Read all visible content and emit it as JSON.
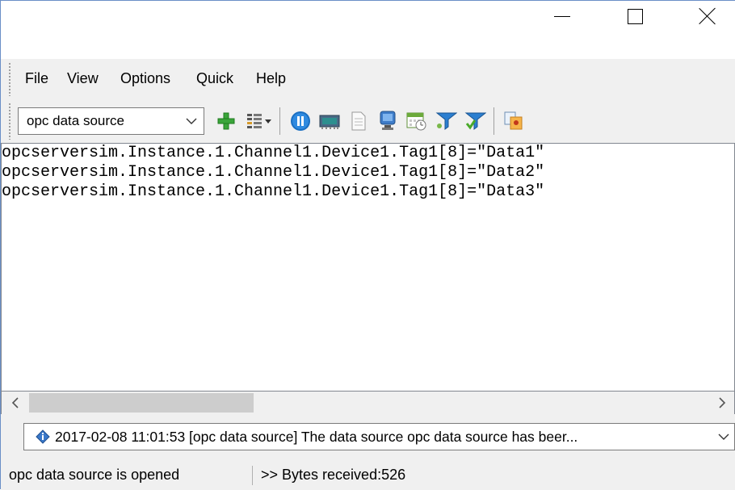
{
  "window": {
    "controls": {
      "minimize_icon": "minimize-icon",
      "maximize_icon": "maximize-icon",
      "close_icon": "close-icon"
    }
  },
  "menu": {
    "items": [
      "File",
      "View",
      "Options",
      "Quick",
      "Help"
    ]
  },
  "toolbar": {
    "source_select": {
      "value": "opc data source"
    },
    "icons": [
      "add-icon",
      "list-options-icon",
      "pause-icon",
      "memory-chip-icon",
      "document-icon",
      "monitor-icon",
      "calendar-icon",
      "filter-icon",
      "filter-apply-icon",
      "copy-icon"
    ]
  },
  "editor": {
    "lines": [
      "opcserversim.Instance.1.Channel1.Device1.Tag1[8]=\"Data1\"",
      "opcserversim.Instance.1.Channel1.Device1.Tag1[8]=\"Data2\"",
      "opcserversim.Instance.1.Channel1.Device1.Tag1[8]=\"Data3\""
    ]
  },
  "log": {
    "text": "2017-02-08 11:01:53 [opc data source] The data source opc data source has beer...",
    "icon": "info-icon"
  },
  "status": {
    "state": "opc data source is opened",
    "bytes": ">> Bytes received:526"
  },
  "colors": {
    "window_border": "#6a8fc7",
    "chrome": "#f0f0f0",
    "scroll_thumb": "#cdcdcd"
  }
}
